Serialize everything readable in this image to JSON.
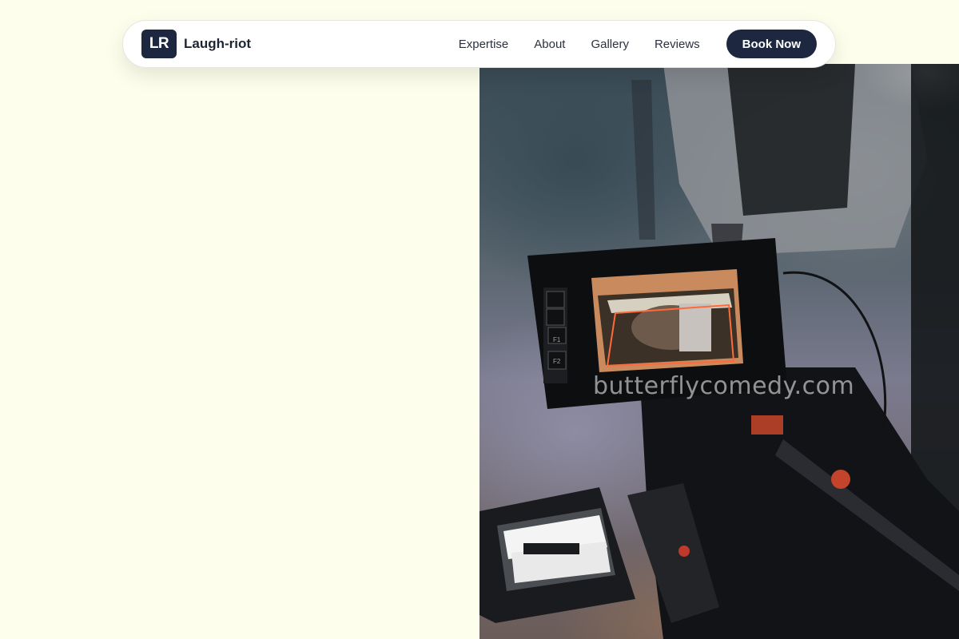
{
  "brand": {
    "mark": "LR",
    "name": "Laugh-riot"
  },
  "nav": {
    "links": [
      {
        "label": "Expertise"
      },
      {
        "label": "About"
      },
      {
        "label": "Gallery"
      },
      {
        "label": "Reviews"
      }
    ],
    "cta_label": "Book Now"
  },
  "hero": {
    "watermark": "butterflycomedy.com",
    "monitor": {
      "side_buttons": [
        "F1",
        "F2"
      ]
    }
  },
  "colors": {
    "page_background": "#fefeec",
    "brand_dark": "#1d2840",
    "nav_text": "#2b3140"
  }
}
